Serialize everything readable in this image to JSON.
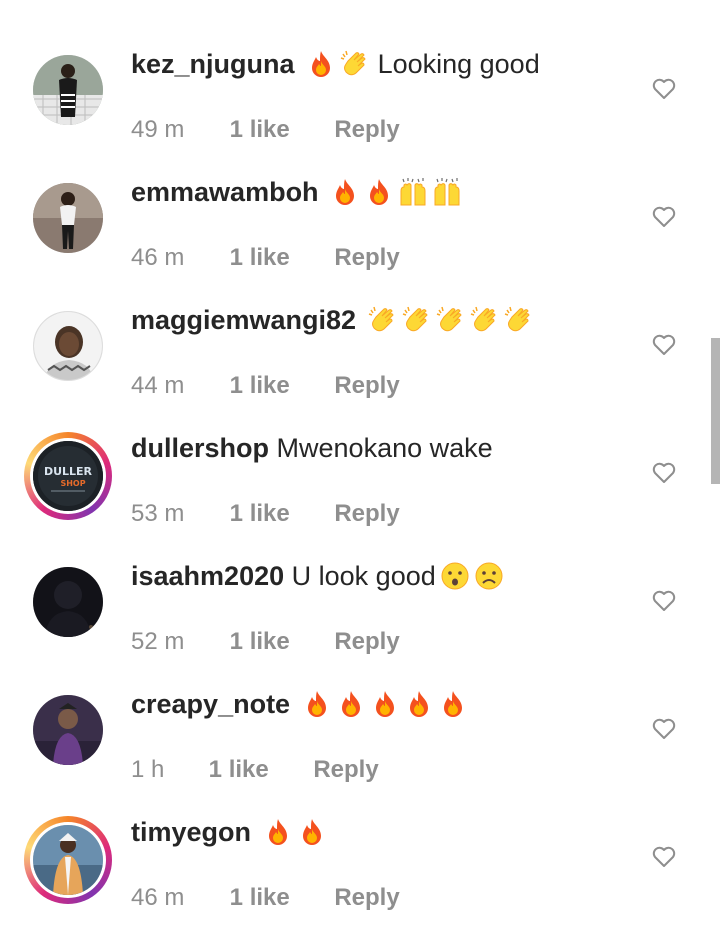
{
  "comments": [
    {
      "username": "kez_njuguna",
      "emojis": [
        "fire-emoji",
        "clapping-hands-emoji"
      ],
      "text": "Looking good",
      "time": "49 m",
      "likes": "1 like",
      "reply": "Reply",
      "has_story_ring": false
    },
    {
      "username": "emmawamboh",
      "emojis": [
        "fire-emoji",
        "fire-emoji",
        "raising-hands-emoji",
        "raising-hands-emoji"
      ],
      "text": "",
      "time": "46 m",
      "likes": "1 like",
      "reply": "Reply",
      "has_story_ring": false
    },
    {
      "username": "maggiemwangi82",
      "emojis": [
        "clapping-hands-emoji",
        "clapping-hands-emoji",
        "clapping-hands-emoji",
        "clapping-hands-emoji",
        "clapping-hands-emoji"
      ],
      "text": "",
      "time": "44 m",
      "likes": "1 like",
      "reply": "Reply",
      "has_story_ring": false
    },
    {
      "username": "dullershop",
      "emojis": [],
      "text": "Mwenokano wake",
      "time": "53 m",
      "likes": "1 like",
      "reply": "Reply",
      "has_story_ring": true,
      "avatar_text": [
        "DULLER",
        "SHOP"
      ]
    },
    {
      "username": "isaahm2020",
      "emojis": [
        "hushed-face-emoji",
        "frowning-face-emoji"
      ],
      "text": "U look good",
      "time": "52 m",
      "likes": "1 like",
      "reply": "Reply",
      "has_story_ring": false
    },
    {
      "username": "creapy_note",
      "emojis": [
        "fire-emoji",
        "fire-emoji",
        "fire-emoji",
        "fire-emoji",
        "fire-emoji"
      ],
      "text": "",
      "time": "1 h",
      "likes": "1 like",
      "reply": "Reply",
      "has_story_ring": false
    },
    {
      "username": "timyegon",
      "emojis": [
        "fire-emoji",
        "fire-emoji"
      ],
      "text": "",
      "time": "46 m",
      "likes": "1 like",
      "reply": "Reply",
      "has_story_ring": true
    }
  ],
  "colors": {
    "username": "#262626",
    "meta": "#8e8e8e",
    "heart_outline": "#8e8e8e",
    "scrollbar": "#b5b5b5"
  }
}
